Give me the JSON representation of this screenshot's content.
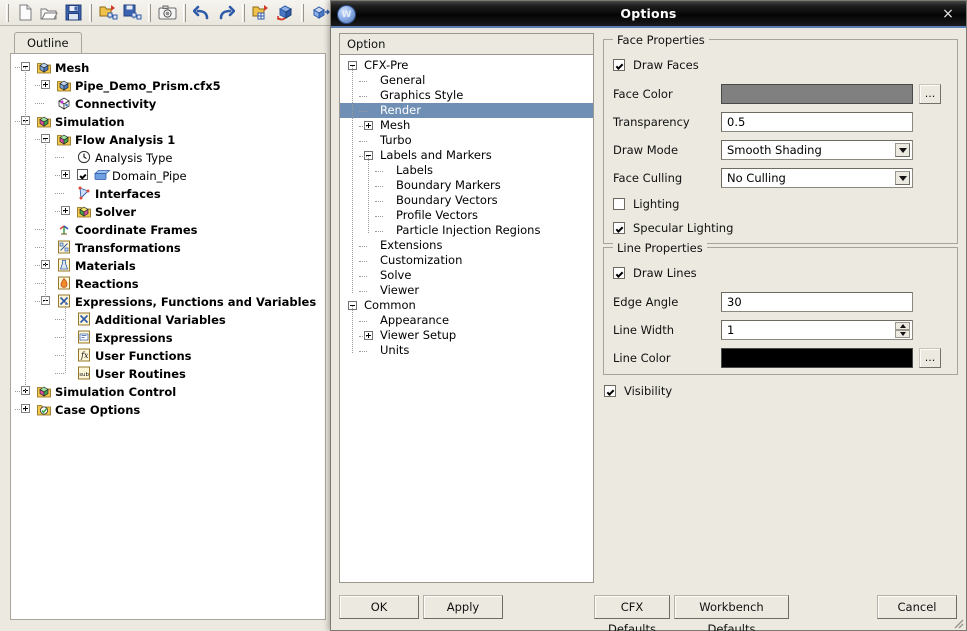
{
  "toolbar": {
    "icons": [
      "new-file-icon",
      "open-folder-icon",
      "save-icon",
      "import-mesh-icon",
      "export-mesh-icon",
      "snapshot-icon",
      "undo-icon",
      "redo-icon",
      "open-case-icon",
      "refresh-mesh-icon",
      "rotate-icon",
      "scale-icon"
    ]
  },
  "outline": {
    "tab_label": "Outline",
    "nodes": [
      {
        "label": "Mesh",
        "indent": 0,
        "bold": true,
        "expander": "minus",
        "icon": "mesh-icon"
      },
      {
        "label": "Pipe_Demo_Prism.cfx5",
        "indent": 1,
        "bold": true,
        "expander": "plus",
        "icon": "mesh-icon"
      },
      {
        "label": "Connectivity",
        "indent": 1,
        "bold": true,
        "expander": "none",
        "icon": "connectivity-icon"
      },
      {
        "label": "Simulation",
        "indent": 0,
        "bold": true,
        "expander": "minus",
        "icon": "simulation-icon"
      },
      {
        "label": "Flow Analysis 1",
        "indent": 1,
        "bold": true,
        "expander": "minus",
        "icon": "flow-analysis-icon"
      },
      {
        "label": "Analysis Type",
        "indent": 2,
        "bold": false,
        "expander": "none",
        "icon": "clock-icon"
      },
      {
        "label": "Domain_Pipe",
        "indent": 2,
        "bold": false,
        "expander": "plus",
        "icon": "domain-icon",
        "checkbox": true
      },
      {
        "label": "Interfaces",
        "indent": 2,
        "bold": true,
        "expander": "none",
        "icon": "interfaces-icon"
      },
      {
        "label": "Solver",
        "indent": 2,
        "bold": true,
        "expander": "plus",
        "icon": "solver-icon"
      },
      {
        "label": "Coordinate Frames",
        "indent": 1,
        "bold": true,
        "expander": "none",
        "icon": "coordinate-frames-icon"
      },
      {
        "label": "Transformations",
        "indent": 1,
        "bold": true,
        "expander": "none",
        "icon": "transformations-icon"
      },
      {
        "label": "Materials",
        "indent": 1,
        "bold": true,
        "expander": "plus",
        "icon": "materials-icon"
      },
      {
        "label": "Reactions",
        "indent": 1,
        "bold": true,
        "expander": "none",
        "icon": "reactions-icon"
      },
      {
        "label": "Expressions, Functions and Variables",
        "indent": 1,
        "bold": true,
        "expander": "minus",
        "icon": "expressions-icon"
      },
      {
        "label": "Additional Variables",
        "indent": 2,
        "bold": true,
        "expander": "none",
        "icon": "additional-variables-icon"
      },
      {
        "label": "Expressions",
        "indent": 2,
        "bold": true,
        "expander": "none",
        "icon": "expression-icon"
      },
      {
        "label": "User Functions",
        "indent": 2,
        "bold": true,
        "expander": "none",
        "icon": "user-functions-icon"
      },
      {
        "label": "User Routines",
        "indent": 2,
        "bold": true,
        "expander": "none",
        "icon": "user-routines-icon"
      },
      {
        "label": "Simulation Control",
        "indent": 0,
        "bold": true,
        "expander": "plus",
        "icon": "simulation-control-icon"
      },
      {
        "label": "Case Options",
        "indent": 0,
        "bold": true,
        "expander": "plus",
        "icon": "case-options-icon"
      }
    ]
  },
  "dialog": {
    "title": "Options",
    "close_label": "×",
    "option_header": "Option",
    "option_tree": [
      {
        "label": "CFX-Pre",
        "indent": 0,
        "expander": "minus",
        "selected": false
      },
      {
        "label": "General",
        "indent": 1,
        "expander": "none",
        "selected": false
      },
      {
        "label": "Graphics Style",
        "indent": 1,
        "expander": "none",
        "selected": false
      },
      {
        "label": "Render",
        "indent": 1,
        "expander": "none",
        "selected": true
      },
      {
        "label": "Mesh",
        "indent": 1,
        "expander": "plus",
        "selected": false
      },
      {
        "label": "Turbo",
        "indent": 1,
        "expander": "none",
        "selected": false
      },
      {
        "label": "Labels and Markers",
        "indent": 1,
        "expander": "minus",
        "selected": false
      },
      {
        "label": "Labels",
        "indent": 2,
        "expander": "none",
        "selected": false
      },
      {
        "label": "Boundary Markers",
        "indent": 2,
        "expander": "none",
        "selected": false
      },
      {
        "label": "Boundary Vectors",
        "indent": 2,
        "expander": "none",
        "selected": false
      },
      {
        "label": "Profile Vectors",
        "indent": 2,
        "expander": "none",
        "selected": false
      },
      {
        "label": "Particle Injection Regions",
        "indent": 2,
        "expander": "none",
        "selected": false
      },
      {
        "label": "Extensions",
        "indent": 1,
        "expander": "none",
        "selected": false
      },
      {
        "label": "Customization",
        "indent": 1,
        "expander": "none",
        "selected": false
      },
      {
        "label": "Solve",
        "indent": 1,
        "expander": "none",
        "selected": false
      },
      {
        "label": "Viewer",
        "indent": 1,
        "expander": "none",
        "selected": false
      },
      {
        "label": "Common",
        "indent": 0,
        "expander": "minus",
        "selected": false
      },
      {
        "label": "Appearance",
        "indent": 1,
        "expander": "none",
        "selected": false
      },
      {
        "label": "Viewer Setup",
        "indent": 1,
        "expander": "plus",
        "selected": false
      },
      {
        "label": "Units",
        "indent": 1,
        "expander": "none",
        "selected": false
      }
    ],
    "face_properties": {
      "group_label": "Face Properties",
      "draw_faces_label": "Draw Faces",
      "draw_faces_checked": true,
      "face_color_label": "Face Color",
      "face_color_value": "#808080",
      "face_color_browse_label": "...",
      "transparency_label": "Transparency",
      "transparency_value": "0.5",
      "draw_mode_label": "Draw Mode",
      "draw_mode_value": "Smooth Shading",
      "face_culling_label": "Face Culling",
      "face_culling_value": "No Culling",
      "lighting_label": "Lighting",
      "lighting_checked": false,
      "specular_label": "Specular Lighting",
      "specular_checked": true
    },
    "line_properties": {
      "group_label": "Line Properties",
      "draw_lines_label": "Draw Lines",
      "draw_lines_checked": true,
      "edge_angle_label": "Edge Angle",
      "edge_angle_value": "30",
      "line_width_label": "Line Width",
      "line_width_value": "1",
      "line_color_label": "Line Color",
      "line_color_value": "#000000",
      "line_color_browse_label": "..."
    },
    "visibility_label": "Visibility",
    "visibility_checked": true,
    "buttons": {
      "ok": "OK",
      "apply": "Apply",
      "cfx_defaults": "CFX Defaults",
      "workbench_defaults": "Workbench Defaults",
      "cancel": "Cancel"
    }
  },
  "colors": {
    "selection_blue": "#6f90b4",
    "dialog_bg": "#ece9e0",
    "titlebar_accent": "#5d7fb4"
  }
}
